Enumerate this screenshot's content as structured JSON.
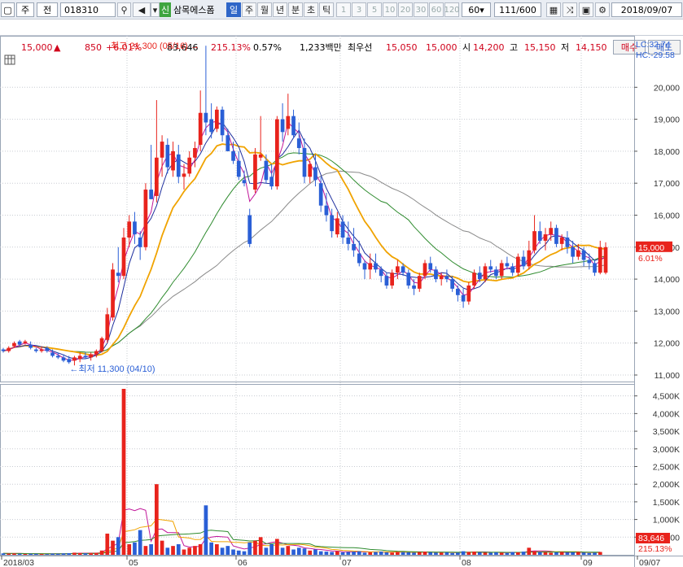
{
  "toolbar": {
    "market": "주",
    "market_type": "전",
    "code": "018310",
    "badge": "신",
    "name": "삼목에스폼",
    "periods": [
      "일",
      "주",
      "월",
      "년",
      "분",
      "초",
      "틱"
    ],
    "active_period": "일",
    "intervals": [
      "1",
      "3",
      "5",
      "10",
      "20",
      "30",
      "60",
      "120"
    ],
    "interval_value": "60",
    "count": "111",
    "count_max": "/600",
    "date": "2018/09/07"
  },
  "quote": {
    "price": "15,000",
    "direction": "▲",
    "change": "850",
    "change_pct": "+6.01%",
    "volume": "83,646",
    "volume_ratio": "215.13%",
    "turnover": "0.57%",
    "amount": "1,233백만",
    "best_bid_label": "최우선",
    "best_ask": "15,050",
    "best_bid": "15,000",
    "open_label": "시",
    "open": "14,200",
    "high_label": "고",
    "high": "15,150",
    "low_label": "저",
    "low": "14,150",
    "buy_label": "매수",
    "sell_label": "매도"
  },
  "colors": {
    "up": "#e8231c",
    "down": "#2a5fd6",
    "ma5": "#c1179a",
    "ma10": "#1e2f9e",
    "ma20": "#f0a300",
    "ma60": "#2e8b2e",
    "ma120": "#8a8a8a",
    "grid": "#c8ccd2"
  },
  "chart_data": {
    "type": "candlestick",
    "x_ticks": [
      "2018/03",
      "05",
      "06",
      "07",
      "08",
      "09",
      "09/07"
    ],
    "price_axis": {
      "min": 11000,
      "max": 21000,
      "ticks": [
        "11,000",
        "12,000",
        "13,000",
        "14,000",
        "15,000",
        "16,000",
        "17,000",
        "18,000",
        "19,000",
        "20,000"
      ]
    },
    "volume_axis": {
      "min": 0,
      "max": 4700,
      "ticks": [
        "500,000",
        "1,000K",
        "1,500K",
        "2,000K",
        "2,500K",
        "3,000K",
        "3,500K",
        "4,000K",
        "4,500K"
      ]
    },
    "annotations": {
      "high": "최고 21,300 (05/16)",
      "low": "최저 11,300 (04/10)",
      "lc": "LC:32.74",
      "hc": "HC:-29.58",
      "last_price": "15,000",
      "last_pct": "6.01%",
      "last_volume": "83,646",
      "last_volume_pct": "215.13%"
    },
    "candles": [
      [
        11800,
        11850,
        11700,
        11750
      ],
      [
        11750,
        11900,
        11700,
        11850
      ],
      [
        11900,
        12050,
        11850,
        12000
      ],
      [
        12050,
        12100,
        11900,
        11950
      ],
      [
        12000,
        12100,
        11950,
        12050
      ],
      [
        11950,
        12050,
        11800,
        11850
      ],
      [
        11800,
        11850,
        11700,
        11750
      ],
      [
        11750,
        11900,
        11700,
        11800
      ],
      [
        11850,
        11900,
        11700,
        11750
      ],
      [
        11700,
        11800,
        11550,
        11600
      ],
      [
        11600,
        11700,
        11500,
        11550
      ],
      [
        11550,
        11650,
        11400,
        11450
      ],
      [
        11500,
        11600,
        11350,
        11400
      ],
      [
        11450,
        11600,
        11300,
        11550
      ],
      [
        11500,
        11700,
        11400,
        11600
      ],
      [
        11600,
        11700,
        11500,
        11550
      ],
      [
        11550,
        11700,
        11450,
        11650
      ],
      [
        11650,
        11800,
        11550,
        11750
      ],
      [
        11750,
        12200,
        11700,
        12150
      ],
      [
        12100,
        13100,
        12000,
        12900
      ],
      [
        12800,
        14500,
        12700,
        14300
      ],
      [
        14200,
        15000,
        13900,
        14100
      ],
      [
        14100,
        15600,
        14000,
        15300
      ],
      [
        15300,
        16000,
        15000,
        15800
      ],
      [
        15800,
        16100,
        15100,
        15400
      ],
      [
        15300,
        15500,
        14600,
        15000
      ],
      [
        15000,
        17000,
        14900,
        16800
      ],
      [
        16800,
        18200,
        16500,
        16500
      ],
      [
        16600,
        19600,
        16400,
        17800
      ],
      [
        17800,
        18500,
        17200,
        18300
      ],
      [
        18200,
        18400,
        17300,
        17500
      ],
      [
        17400,
        18300,
        17200,
        18000
      ],
      [
        17900,
        18200,
        17000,
        17200
      ],
      [
        17200,
        17600,
        16800,
        17300
      ],
      [
        17300,
        18000,
        17200,
        17800
      ],
      [
        17800,
        18300,
        17500,
        18100
      ],
      [
        18200,
        19900,
        18000,
        19200
      ],
      [
        19200,
        21300,
        18500,
        18900
      ],
      [
        19000,
        19500,
        18400,
        18600
      ],
      [
        18700,
        19400,
        18600,
        19300
      ],
      [
        19300,
        19400,
        18300,
        18500
      ],
      [
        18500,
        18700,
        18000,
        18000
      ],
      [
        18000,
        18300,
        17600,
        17700
      ],
      [
        17700,
        18000,
        17100,
        17200
      ],
      [
        17100,
        17400,
        16900,
        17000
      ],
      [
        16000,
        16200,
        15000,
        15100
      ],
      [
        16800,
        18100,
        16700,
        17900
      ],
      [
        17800,
        19100,
        17700,
        17900
      ],
      [
        17700,
        17900,
        17000,
        17100
      ],
      [
        17200,
        17600,
        16800,
        16900
      ],
      [
        16900,
        19100,
        16800,
        19000
      ],
      [
        19000,
        19500,
        18300,
        18600
      ],
      [
        18700,
        19800,
        18500,
        19100
      ],
      [
        19100,
        19300,
        18400,
        18500
      ],
      [
        18400,
        18900,
        17900,
        18100
      ],
      [
        18100,
        18400,
        17000,
        17200
      ],
      [
        17200,
        17700,
        17000,
        17600
      ],
      [
        17500,
        17900,
        16900,
        17100
      ],
      [
        17000,
        17200,
        16100,
        16300
      ],
      [
        16300,
        16700,
        15800,
        16000
      ],
      [
        16000,
        16200,
        15300,
        15500
      ],
      [
        15400,
        16100,
        15300,
        15900
      ],
      [
        15800,
        16000,
        15100,
        15300
      ],
      [
        15300,
        15800,
        14900,
        15100
      ],
      [
        15100,
        15600,
        14700,
        14900
      ],
      [
        14800,
        15200,
        14400,
        14500
      ],
      [
        14500,
        14600,
        14000,
        14300
      ],
      [
        14300,
        14800,
        14000,
        14500
      ],
      [
        14500,
        14800,
        14200,
        14300
      ],
      [
        14300,
        14400,
        13900,
        14100
      ],
      [
        14100,
        14200,
        13700,
        13800
      ],
      [
        13800,
        14300,
        13700,
        14200
      ],
      [
        14200,
        14600,
        14000,
        14400
      ],
      [
        14400,
        14500,
        14100,
        14200
      ],
      [
        14200,
        14300,
        13700,
        13800
      ],
      [
        13800,
        14000,
        13500,
        13700
      ],
      [
        13700,
        14200,
        13600,
        14100
      ],
      [
        14100,
        14600,
        14000,
        14500
      ],
      [
        14500,
        14700,
        14200,
        14300
      ],
      [
        14300,
        14400,
        13900,
        14000
      ],
      [
        14000,
        14200,
        13800,
        14100
      ],
      [
        14100,
        14300,
        13900,
        14000
      ],
      [
        14000,
        14100,
        13600,
        13700
      ],
      [
        13700,
        13800,
        13300,
        13500
      ],
      [
        13500,
        13700,
        13100,
        13300
      ],
      [
        13300,
        13900,
        13200,
        13800
      ],
      [
        13800,
        14300,
        13700,
        14200
      ],
      [
        14200,
        14400,
        13900,
        14000
      ],
      [
        14000,
        14500,
        13900,
        14400
      ],
      [
        14400,
        14600,
        14200,
        14300
      ],
      [
        14300,
        14400,
        14000,
        14100
      ],
      [
        14100,
        14600,
        14000,
        14500
      ],
      [
        14500,
        14700,
        14300,
        14400
      ],
      [
        14400,
        14500,
        14100,
        14200
      ],
      [
        14200,
        14800,
        14100,
        14700
      ],
      [
        14700,
        14900,
        14300,
        14400
      ],
      [
        14400,
        15200,
        14300,
        14900
      ],
      [
        14900,
        16000,
        14800,
        15500
      ],
      [
        15500,
        15800,
        15100,
        15200
      ],
      [
        15200,
        15600,
        14900,
        15400
      ],
      [
        15400,
        15800,
        15200,
        15600
      ],
      [
        15600,
        15700,
        15000,
        15100
      ],
      [
        15100,
        15400,
        14900,
        15300
      ],
      [
        15300,
        15500,
        14800,
        15000
      ],
      [
        15000,
        15200,
        14500,
        14700
      ],
      [
        14700,
        15100,
        14600,
        14900
      ],
      [
        14900,
        15000,
        14400,
        14600
      ],
      [
        14600,
        14800,
        14300,
        14500
      ],
      [
        14500,
        14600,
        14100,
        14200
      ],
      [
        14200,
        15200,
        14150,
        15000
      ],
      [
        14200,
        15150,
        14150,
        15000
      ]
    ],
    "volumes": [
      40,
      35,
      38,
      30,
      25,
      30,
      28,
      22,
      20,
      35,
      30,
      40,
      45,
      60,
      50,
      40,
      45,
      50,
      120,
      600,
      400,
      500,
      4700,
      300,
      350,
      700,
      250,
      300,
      2000,
      400,
      200,
      250,
      300,
      150,
      200,
      250,
      300,
      1400,
      350,
      300,
      200,
      250,
      150,
      120,
      100,
      350,
      400,
      500,
      200,
      300,
      450,
      200,
      250,
      150,
      200,
      180,
      120,
      150,
      100,
      90,
      80,
      100,
      70,
      80,
      90,
      100,
      60,
      70,
      80,
      90,
      70,
      60,
      80,
      75,
      70,
      60,
      80,
      90,
      70,
      60,
      60,
      70,
      50,
      60,
      100,
      80,
      90,
      70,
      60,
      60,
      70,
      60,
      50,
      80,
      70,
      90,
      200,
      100,
      80,
      70,
      60,
      70,
      80,
      60,
      70,
      80,
      60,
      50,
      60,
      80
    ]
  }
}
